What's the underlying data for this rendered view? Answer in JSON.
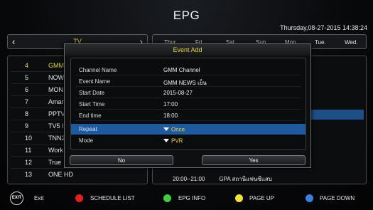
{
  "header": {
    "title": "EPG",
    "datetime": "Thursday,08-27-2015 14:38:24"
  },
  "channel_panel": {
    "group": "TV",
    "channels": [
      {
        "num": "4",
        "name": "GMM"
      },
      {
        "num": "5",
        "name": "NOW"
      },
      {
        "num": "6",
        "name": "MON"
      },
      {
        "num": "7",
        "name": "Amar"
      },
      {
        "num": "8",
        "name": "PPTV"
      },
      {
        "num": "9",
        "name": "TV5 I"
      },
      {
        "num": "10",
        "name": "TNN2"
      },
      {
        "num": "11",
        "name": "Work"
      },
      {
        "num": "12",
        "name": "True"
      },
      {
        "num": "13",
        "name": "ONE HD"
      }
    ]
  },
  "epg": {
    "days": [
      "Thur.",
      "Fri.",
      "Sat.",
      "Sun.",
      "Mon.",
      "Tue.",
      "Wed."
    ],
    "visible_row": {
      "time": "20:00--21:00",
      "program": "GPA สถานีแฟนซีแสบ"
    }
  },
  "dialog": {
    "title": "Event Add",
    "fields": [
      {
        "label": "Channel Name",
        "value": "GMM Channel"
      },
      {
        "label": "Event Name",
        "value": "GMM NEWS เย็น"
      },
      {
        "label": "Start Date",
        "value": "2015-08-27"
      },
      {
        "label": "Start Time",
        "value": "17:00"
      },
      {
        "label": "End time",
        "value": "18:00"
      }
    ],
    "repeat": {
      "label": "Repeat",
      "value": "Once"
    },
    "mode": {
      "label": "Mode",
      "value": "PVR"
    },
    "no_label": "No",
    "yes_label": "Yes"
  },
  "footer": {
    "exit_icon_text": "EXIT",
    "exit_label": "Exit",
    "schedule_label": "SCHEDULE LIST",
    "epg_info_label": "EPG INFO",
    "page_up_label": "PAGE UP",
    "page_down_label": "PAGE DOWN",
    "colors": {
      "red": "#e02020",
      "green": "#3fcf3f",
      "yellow": "#f2e23a",
      "blue": "#3a7fe0",
      "accent_yellow": "#e5d33a",
      "highlight_blue": "#1d5a9e"
    }
  }
}
